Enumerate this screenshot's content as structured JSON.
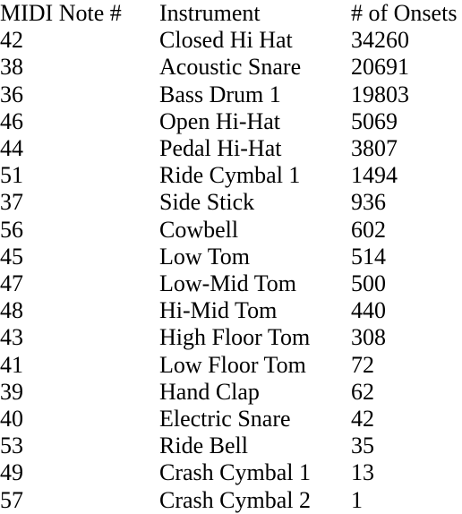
{
  "table": {
    "columns": [
      {
        "key": "note",
        "label": "MIDI Note #"
      },
      {
        "key": "instr",
        "label": "Instrument"
      },
      {
        "key": "onsets",
        "label": "# of Onsets"
      }
    ],
    "rows": [
      {
        "note": "42",
        "instr": "Closed Hi Hat",
        "onsets": "34260"
      },
      {
        "note": "38",
        "instr": "Acoustic Snare",
        "onsets": "20691"
      },
      {
        "note": "36",
        "instr": "Bass Drum 1",
        "onsets": "19803"
      },
      {
        "note": "46",
        "instr": "Open Hi-Hat",
        "onsets": "5069"
      },
      {
        "note": "44",
        "instr": "Pedal Hi-Hat",
        "onsets": "3807"
      },
      {
        "note": "51",
        "instr": "Ride Cymbal 1",
        "onsets": "1494"
      },
      {
        "note": "37",
        "instr": "Side Stick",
        "onsets": "936"
      },
      {
        "note": "56",
        "instr": "Cowbell",
        "onsets": "602"
      },
      {
        "note": "45",
        "instr": "Low Tom",
        "onsets": "514"
      },
      {
        "note": "47",
        "instr": "Low-Mid Tom",
        "onsets": "500"
      },
      {
        "note": "48",
        "instr": "Hi-Mid Tom",
        "onsets": "440"
      },
      {
        "note": "43",
        "instr": "High Floor Tom",
        "onsets": "308"
      },
      {
        "note": "41",
        "instr": "Low Floor Tom",
        "onsets": "72"
      },
      {
        "note": "39",
        "instr": "Hand Clap",
        "onsets": "62"
      },
      {
        "note": "40",
        "instr": "Electric Snare",
        "onsets": "42"
      },
      {
        "note": "53",
        "instr": "Ride Bell",
        "onsets": "35"
      },
      {
        "note": "49",
        "instr": "Crash Cymbal 1",
        "onsets": "13"
      },
      {
        "note": "57",
        "instr": "Crash Cymbal 2",
        "onsets": "1"
      }
    ]
  },
  "style": {
    "text_color": "#000000",
    "background_color": "#ffffff"
  }
}
